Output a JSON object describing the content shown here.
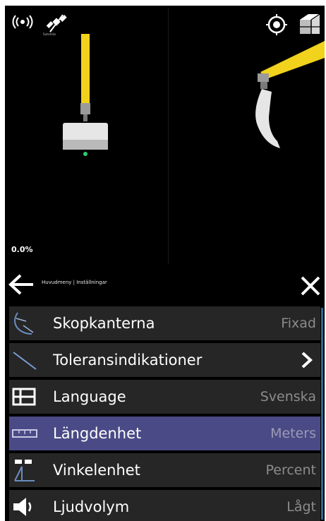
{
  "status_bar": {
    "signal_icon": "radio-signal-icon",
    "gnss_icon": "satellite-icon",
    "gnss_caption": "Satellite",
    "target_icon": "target-icon",
    "view_icon": "3d-view-icon"
  },
  "viewport": {
    "percent_readout": "0.0%",
    "colors": {
      "arm": "#f1d21c",
      "bucket": "#e6e6e6",
      "background": "#000000"
    }
  },
  "menu": {
    "breadcrumb": "Huvudmeny | Inställningar",
    "back_icon": "arrow-left-icon",
    "close_icon": "close-icon",
    "items": [
      {
        "label": "Skopkanterna",
        "value": "Fixad",
        "icon": "bucket-edge-icon"
      },
      {
        "label": "Toleransindikationer",
        "value": "",
        "icon": "tolerance-line-icon",
        "has_chevron": true
      },
      {
        "label": "Language",
        "value": "Svenska",
        "icon": "language-table-icon"
      },
      {
        "label": "Längdenhet",
        "value": "Meters",
        "icon": "ruler-icon",
        "selected": true
      },
      {
        "label": "Vinkelenhet",
        "value": "Percent",
        "icon": "angle-unit-icon"
      },
      {
        "label": "Ljudvolym",
        "value": "Lågt",
        "icon": "speaker-icon"
      }
    ],
    "colors": {
      "row_bg": "#262626",
      "selected_bg": "#4a4a86",
      "value_text": "#8c8c8c",
      "scrollbar": "#2f6a95"
    }
  }
}
